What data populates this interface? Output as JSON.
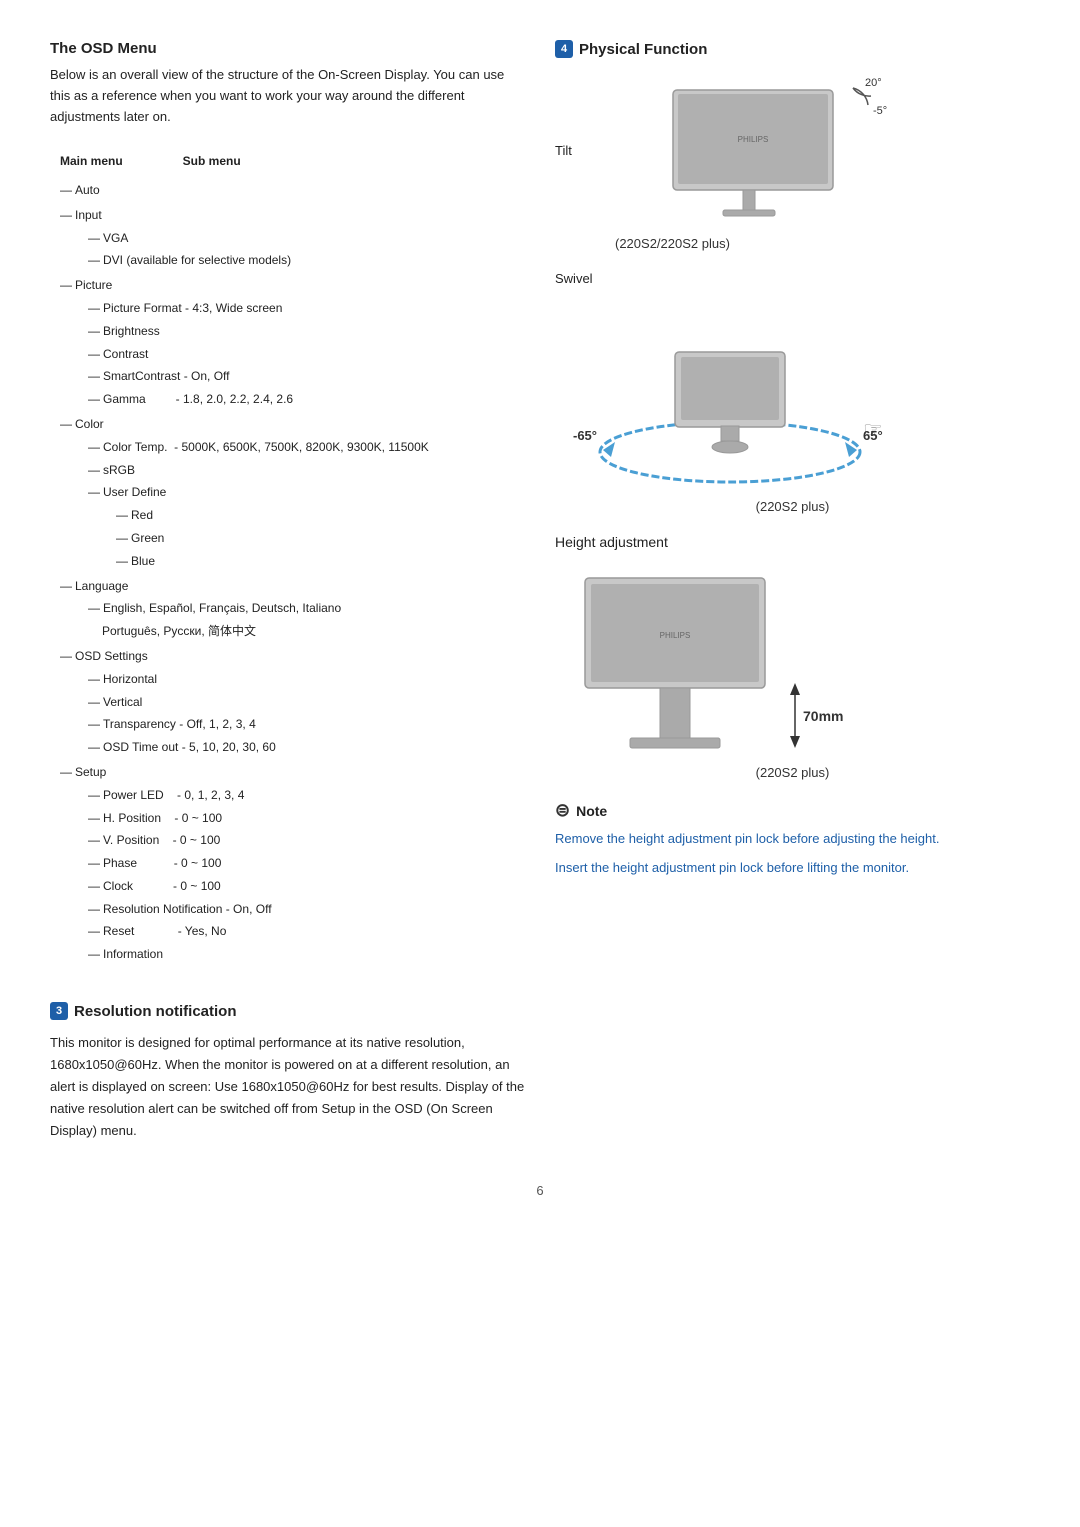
{
  "osd": {
    "title": "The OSD Menu",
    "description": "Below is an overall view of the structure of the On-Screen Display. You can use this as a reference when you want to work your way around the different adjustments later on.",
    "menu_headers": [
      "Main menu",
      "Sub menu"
    ],
    "menu_items": [
      {
        "level": 0,
        "main": "Auto",
        "sub": ""
      },
      {
        "level": 0,
        "main": "Input",
        "sub": ""
      },
      {
        "level": 1,
        "main": "",
        "sub": "VGA"
      },
      {
        "level": 1,
        "main": "",
        "sub": "DVI (available for selective models)"
      },
      {
        "level": 0,
        "main": "Picture",
        "sub": ""
      },
      {
        "level": 1,
        "main": "",
        "sub": "Picture Format - 4:3, Wide screen"
      },
      {
        "level": 1,
        "main": "",
        "sub": "Brightness"
      },
      {
        "level": 1,
        "main": "",
        "sub": "Contrast"
      },
      {
        "level": 1,
        "main": "",
        "sub": "SmartContrast - On, Off"
      },
      {
        "level": 1,
        "main": "",
        "sub": "Gamma         - 1.8, 2.0, 2.2, 2.4, 2.6"
      },
      {
        "level": 0,
        "main": "Color",
        "sub": ""
      },
      {
        "level": 1,
        "main": "",
        "sub": "Color Temp.  - 5000K, 6500K, 7500K, 8200K, 9300K, 11500K"
      },
      {
        "level": 1,
        "main": "",
        "sub": "sRGB"
      },
      {
        "level": 1,
        "main": "",
        "sub": "User Define"
      },
      {
        "level": 2,
        "main": "",
        "sub": "Red"
      },
      {
        "level": 2,
        "main": "",
        "sub": "Green"
      },
      {
        "level": 2,
        "main": "",
        "sub": "Blue"
      },
      {
        "level": 0,
        "main": "Language",
        "sub": ""
      },
      {
        "level": 1,
        "main": "",
        "sub": "English, Español, Français, Deutsch, Italiano"
      },
      {
        "level": 1,
        "main": "",
        "sub": "Português, Pyccки, 简体中文"
      },
      {
        "level": 0,
        "main": "OSD Settings",
        "sub": ""
      },
      {
        "level": 1,
        "main": "",
        "sub": "Horizontal"
      },
      {
        "level": 1,
        "main": "",
        "sub": "Vertical"
      },
      {
        "level": 1,
        "main": "",
        "sub": "Transparency - Off, 1, 2, 3, 4"
      },
      {
        "level": 1,
        "main": "",
        "sub": "OSD Time out - 5, 10, 20, 30, 60"
      },
      {
        "level": 0,
        "main": "Setup",
        "sub": ""
      },
      {
        "level": 1,
        "main": "",
        "sub": "Power LED      - 0, 1, 2, 3, 4"
      },
      {
        "level": 1,
        "main": "",
        "sub": "H. Position    - 0 ~ 100"
      },
      {
        "level": 1,
        "main": "",
        "sub": "V. Position    - 0 ~ 100"
      },
      {
        "level": 1,
        "main": "",
        "sub": "Phase           - 0 ~ 100"
      },
      {
        "level": 1,
        "main": "",
        "sub": "Clock            - 0 ~ 100"
      },
      {
        "level": 1,
        "main": "",
        "sub": "Resolution Notification - On, Off"
      },
      {
        "level": 1,
        "main": "",
        "sub": "Reset               - Yes, No"
      },
      {
        "level": 1,
        "main": "",
        "sub": "Information"
      }
    ]
  },
  "section3": {
    "num": "3",
    "title": "Resolution notification",
    "body": "This monitor is designed for optimal performance at its native resolution, 1680x1050@60Hz. When the monitor is powered on at a different resolution, an alert is displayed on screen: Use 1680x1050@60Hz for best results. Display of the native resolution alert can be switched off from Setup in the OSD (On Screen Display) menu."
  },
  "section4": {
    "num": "4",
    "title": "Physical Function"
  },
  "tilt": {
    "label": "Tilt",
    "angle_up": "20°",
    "angle_down": "-5°",
    "model_note": "(220S2/220S2 plus)"
  },
  "swivel": {
    "label": "Swivel",
    "angle_left": "-65°",
    "angle_right": "65°",
    "model_note": "(220S2 plus)"
  },
  "height": {
    "label": "Height adjustment",
    "measurement": "70mm",
    "model_note": "(220S2 plus)"
  },
  "note": {
    "title": "Note",
    "text1": "Remove the height adjustment pin lock before adjusting the height.",
    "text2": "Insert the height adjustment pin lock before lifting the monitor."
  },
  "page": {
    "number": "6"
  }
}
